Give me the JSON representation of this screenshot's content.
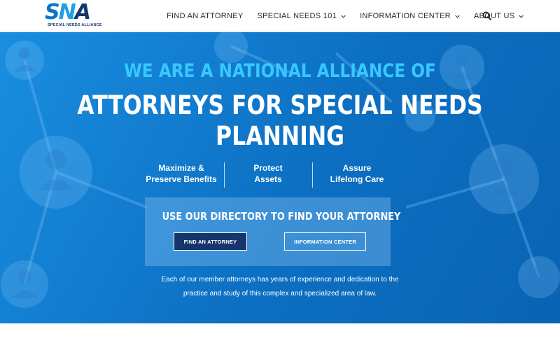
{
  "logo": {
    "mark_s": "S",
    "mark_n": "N",
    "mark_a": "A",
    "subtitle": "SPECIAL NEEDS ALLIANCE"
  },
  "nav": {
    "items": [
      {
        "label": "FIND AN ATTORNEY",
        "has_dropdown": false
      },
      {
        "label": "SPECIAL NEEDS 101",
        "has_dropdown": true
      },
      {
        "label": "INFORMATION CENTER",
        "has_dropdown": true
      },
      {
        "label": "ABOUT US",
        "has_dropdown": true
      }
    ],
    "search_icon": "search-icon"
  },
  "hero": {
    "line1": "WE ARE A NATIONAL ALLIANCE OF",
    "line2a": "ATTORNEYS FOR SPECIAL NEEDS",
    "line2b": "PLANNING",
    "benefits": [
      {
        "line1": "Maximize &",
        "line2": "Preserve Benefits"
      },
      {
        "line1": "Protect",
        "line2": "Assets"
      },
      {
        "line1": "Assure",
        "line2": "Lifelong Care"
      }
    ],
    "directory_title": "USE OUR DIRECTORY TO FIND YOUR ATTORNEY",
    "find_button": "FIND AN ATTORNEY",
    "info_button": "INFORMATION CENTER",
    "description_line1": "Each of our member attorneys has years of experience and dedication to the",
    "description_line2": "practice and study of this complex and specialized area of law."
  },
  "colors": {
    "brand_dark": "#15356b",
    "brand_light": "#37c8ff",
    "hero_blue": "#0c6fc2"
  }
}
